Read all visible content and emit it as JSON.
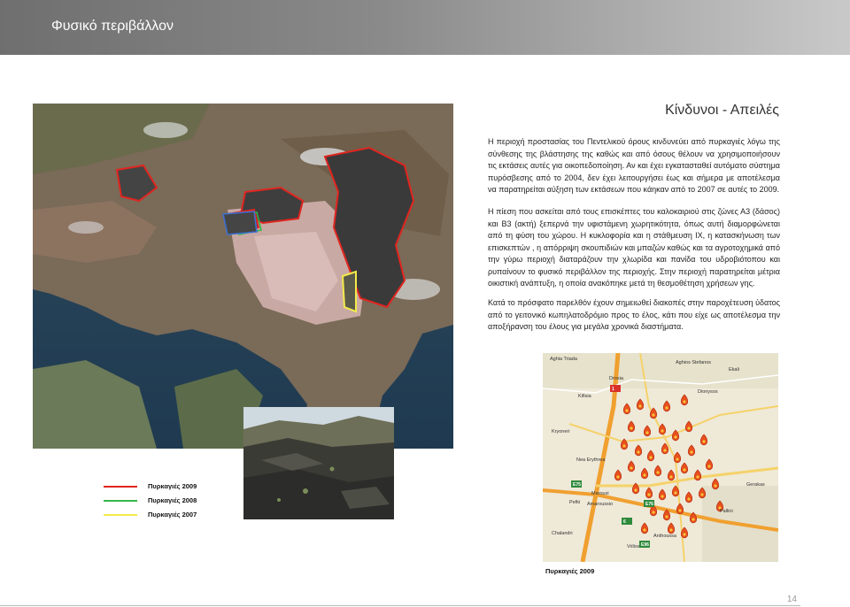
{
  "header": {
    "title": "Φυσικό περιβάλλον"
  },
  "section": {
    "title": "Κίνδυνοι - Απειλές",
    "paragraphs": [
      "Η περιοχή προστασίας του Πεντελικού όρους κινδυνεύει από πυρκαγιές λόγω της σύνθεσης της βλάστησης της καθώς και από όσους θέλουν να χρησιμοποιήσουν τις εκτάσεις αυτές για οικοπεδοποίηση. Αν και έχει εγκατασταθεί αυτόματο σύστημα πυρόσβεσης από το 2004, δεν έχει λειτουργήσει έως και σήμερα με αποτέλεσμα να παρατηρείται αύξηση των εκτάσεων που κάηκαν από το 2007 σε αυτές το 2009.",
      "Η πίεση που ασκείται από τους επισκέπτες του καλοκαιριού στις ζώνες Α3 (δάσος) και Β3 (ακτή) ξεπερνά την υφιστάμενη χωρητικότητα, όπως αυτή διαμορφώνεται από τη φύση του χώρου. Η κυκλοφορία και η στάθμευση ΙΧ, η κατασκήνωση των επισκεπτών , η απόρριψη σκουπιδιών και μπαζών καθώς και τα αγροτοχημικά από την γύρω περιοχή διαταράζουν την χλωρίδα και πανίδα του υδροβιότοπου και ρυπαίνουν το φυσικό περιβάλλον της περιοχής. Στην περιοχή παρατηρείται μέτρια οικιστική ανάπτυξη, η οποία ανακόπηκε μετά τη θεσμοθέτηση χρήσεων γης.",
      "Κατά το πρόσφατο παρελθόν έχουν σημειωθεί διακοπές στην παροχέτευση ύδατος από το γειτονικό κωπηλατοδρόμιο προς το έλος, κάτι που είχε ως αποτέλεσμα την αποξήρανση του έλους για μεγάλα χρονικά διαστήματα."
    ]
  },
  "legend": {
    "items": [
      {
        "label": "Πυρκαγιές 2009",
        "color": "#e0251f"
      },
      {
        "label": "Πυρκαγιές 2008",
        "color": "#35b64a"
      },
      {
        "label": "Πυρκαγιές 2007",
        "color": "#f2ea4a"
      }
    ]
  },
  "road_map": {
    "caption": "Πυρκαγιές 2009",
    "place_labels": [
      "Aghia Triada",
      "Aghios Stefanos",
      "Kifisia",
      "Nea Erythrea",
      "Dionysos",
      "Marousi",
      "Amaroussio",
      "Pefki",
      "Vrilissia",
      "Chalandri",
      "Anthoussa",
      "Pallini",
      "Ekali",
      "Kryoneri",
      "Drosia",
      "Gerakas"
    ],
    "road_markers": [
      "1",
      "E75",
      "E76",
      "6",
      "E96"
    ]
  },
  "footer": {
    "page_number": "14"
  },
  "colors": {
    "header_gradient_start": "#6f6f6f",
    "header_gradient_end": "#c9c9c9",
    "fire_2009": "#e0251f",
    "fire_2008": "#35b64a",
    "fire_2007": "#f2ea4a"
  }
}
